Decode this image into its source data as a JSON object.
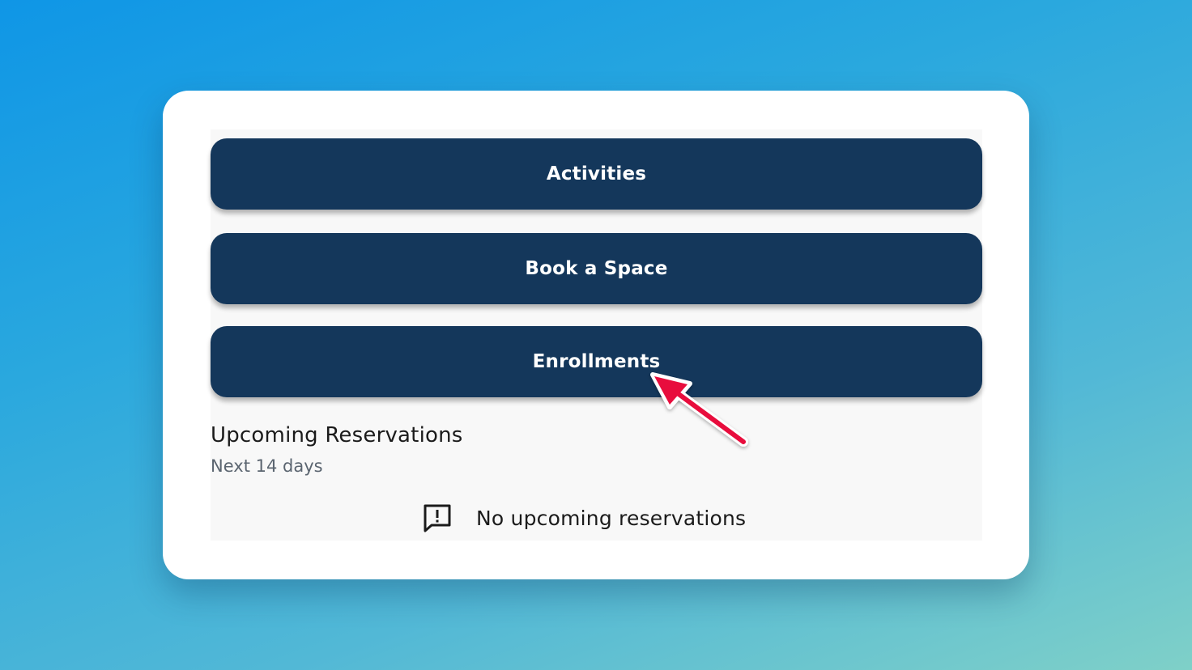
{
  "buttons": {
    "activities": "Activities",
    "book_space": "Book a Space",
    "enrollments": "Enrollments"
  },
  "reservations": {
    "title": "Upcoming Reservations",
    "subtitle": "Next 14 days",
    "empty_message": "No upcoming reservations",
    "empty_icon": "comment-alert-icon"
  },
  "colors": {
    "button_background": "#14375b",
    "button_text": "#ffffff",
    "annotation_arrow": "#e8103c"
  }
}
